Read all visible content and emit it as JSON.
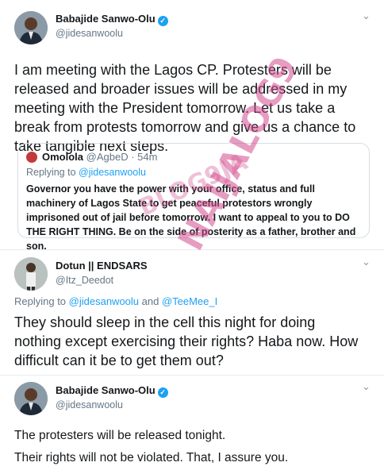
{
  "tweet1": {
    "name": "Babajide Sanwo-Olu",
    "handle": "@jidesanwoolu",
    "text": "I am meeting with the Lagos CP.  Protesters will be released and broader issues will be addressed in my meeting with the President tomorrow. Let us take a break from protests tomorrow and give us a chance to take tangible next steps."
  },
  "quoted": {
    "name": "Omolola",
    "meta": "@AgbeD · 54m",
    "reply_prefix": "Replying to ",
    "reply_to": "@jidesanwoolu",
    "text": "Governor you have the power with your office, status and full machinery of Lagos State to get peaceful protestors wrongly imprisoned  out of jail before tomorrow. I want to appeal to you to DO THE RIGHT THING. Be on the side of posterity as a father, brother and son."
  },
  "tweet2": {
    "name": "Dotun || ENDSARS",
    "handle": "@Itz_Deedot",
    "reply_prefix": "Replying to ",
    "reply_to_1": "@jidesanwoolu",
    "reply_and": " and ",
    "reply_to_2": "@TeeMee_I",
    "text": "They should sleep in the cell this night for doing nothing except exercising their rights? Haba now. How difficult can it be to get them out?"
  },
  "tweet3": {
    "name": "Babajide Sanwo-Olu",
    "handle": "@jidesanwoolu",
    "line1": "The protesters will be released tonight.",
    "line2": "Their rights will not be violated. That, I assure you."
  },
  "watermark": {
    "text1": "NAIJALOG9",
    "text2": "BLOG9JA"
  },
  "icons": {
    "verified": "✓",
    "chevron": "⌄"
  },
  "colors": {
    "link": "#1da1f2",
    "secondary": "#657786",
    "watermark": "#d44d8f"
  }
}
